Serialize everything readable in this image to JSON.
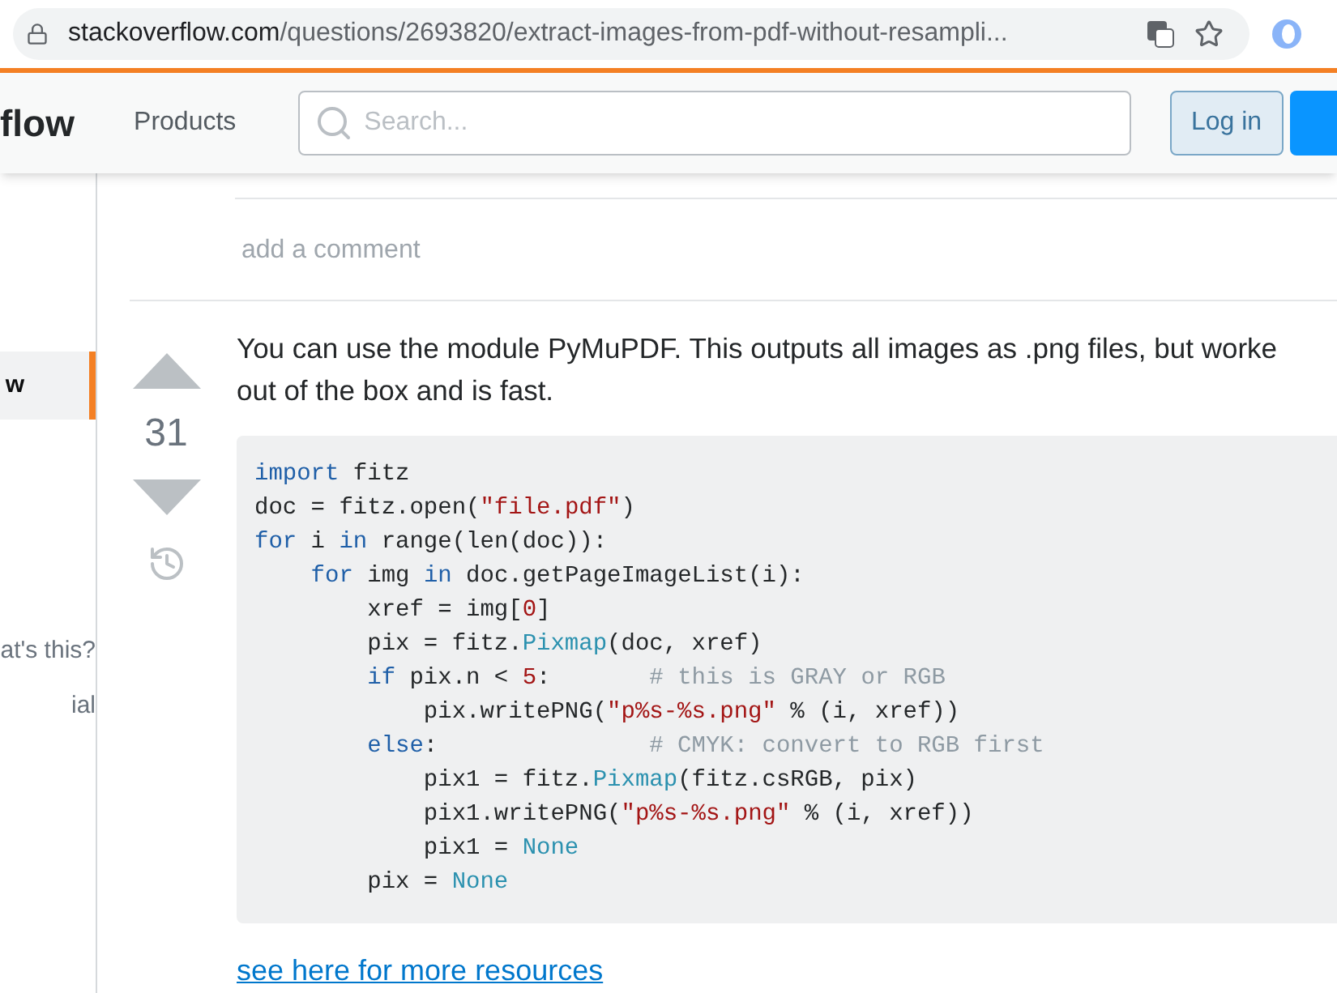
{
  "browser": {
    "url_host": "stackoverflow.com",
    "url_path": "/questions/2693820/extract-images-from-pdf-without-resampli..."
  },
  "header": {
    "logo": "flow",
    "nav": "Products",
    "search": {
      "placeholder": "Search..."
    },
    "login": "Log in"
  },
  "sidebar": {
    "items": [
      {
        "label": "w",
        "selected": true
      },
      {
        "label": "at's this?",
        "selected": false
      },
      {
        "label": "ial",
        "selected": false
      }
    ]
  },
  "comments": {
    "add": "add a comment"
  },
  "answer": {
    "votes": "31",
    "text_lines": [
      "You can use the module PyMuPDF. This outputs all images as .png files, but worke",
      "out of the box and is fast."
    ],
    "code": [
      [
        {
          "kind": "kw",
          "t": "import"
        },
        {
          "kind": "plain",
          "t": " fitz"
        }
      ],
      [
        {
          "kind": "plain",
          "t": "doc = fitz.open("
        },
        {
          "kind": "str",
          "t": "\"file.pdf\""
        },
        {
          "kind": "plain",
          "t": ")"
        }
      ],
      [
        {
          "kind": "kw",
          "t": "for"
        },
        {
          "kind": "plain",
          "t": " i "
        },
        {
          "kind": "kw",
          "t": "in"
        },
        {
          "kind": "plain",
          "t": " range(len(doc)):"
        }
      ],
      [
        {
          "kind": "kw",
          "t": "    for"
        },
        {
          "kind": "plain",
          "t": " img "
        },
        {
          "kind": "kw",
          "t": "in"
        },
        {
          "kind": "plain",
          "t": " doc.getPageImageList(i):"
        }
      ],
      [
        {
          "kind": "plain",
          "t": "        xref = img["
        },
        {
          "kind": "num",
          "t": "0"
        },
        {
          "kind": "plain",
          "t": "]"
        }
      ],
      [
        {
          "kind": "plain",
          "t": "        pix = fitz."
        },
        {
          "kind": "type",
          "t": "Pixmap"
        },
        {
          "kind": "plain",
          "t": "(doc, xref)"
        }
      ],
      [
        {
          "kind": "kw",
          "t": "        if"
        },
        {
          "kind": "plain",
          "t": " pix.n < "
        },
        {
          "kind": "num",
          "t": "5"
        },
        {
          "kind": "plain",
          "t": ":       "
        },
        {
          "kind": "comment",
          "t": "# this is GRAY or RGB"
        }
      ],
      [
        {
          "kind": "plain",
          "t": "            pix.writePNG("
        },
        {
          "kind": "str",
          "t": "\"p%s-%s.png\""
        },
        {
          "kind": "plain",
          "t": " % (i, xref))"
        }
      ],
      [
        {
          "kind": "kw",
          "t": "        else"
        },
        {
          "kind": "plain",
          "t": ":               "
        },
        {
          "kind": "comment",
          "t": "# CMYK: convert to RGB first"
        }
      ],
      [
        {
          "kind": "plain",
          "t": "            pix1 = fitz."
        },
        {
          "kind": "type",
          "t": "Pixmap"
        },
        {
          "kind": "plain",
          "t": "(fitz.csRGB, pix)"
        }
      ],
      [
        {
          "kind": "plain",
          "t": "            pix1.writePNG("
        },
        {
          "kind": "str",
          "t": "\"p%s-%s.png\""
        },
        {
          "kind": "plain",
          "t": " % (i, xref))"
        }
      ],
      [
        {
          "kind": "plain",
          "t": "            pix1 = "
        },
        {
          "kind": "type",
          "t": "None"
        }
      ],
      [
        {
          "kind": "plain",
          "t": "        pix = "
        },
        {
          "kind": "type",
          "t": "None"
        }
      ]
    ],
    "link": "see here for more resources"
  }
}
